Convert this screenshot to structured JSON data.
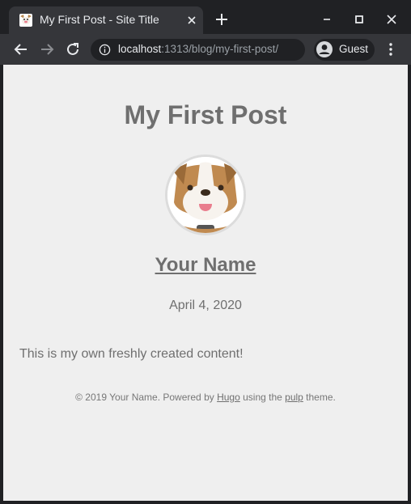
{
  "browser": {
    "tab_title": "My First Post - Site Title",
    "url_host": "localhost",
    "url_rest": ":1313/blog/my-first-post/",
    "profile_label": "Guest"
  },
  "post": {
    "title": "My First Post",
    "author": "Your Name",
    "date": "April 4, 2020",
    "content": "This is my own freshly created content!"
  },
  "footer": {
    "prefix": "© 2019 Your Name. Powered by ",
    "hugo_link": "Hugo",
    "middle": " using the ",
    "theme_link": "pulp",
    "suffix": " theme."
  },
  "icons": {
    "favicon": "bulldog-favicon-icon",
    "close": "close-icon",
    "new_tab": "plus-icon",
    "back": "arrow-left-icon",
    "forward": "arrow-right-icon",
    "reload": "reload-icon",
    "info": "info-icon",
    "profile": "account-circle-icon",
    "menu": "kebab-menu-icon"
  }
}
